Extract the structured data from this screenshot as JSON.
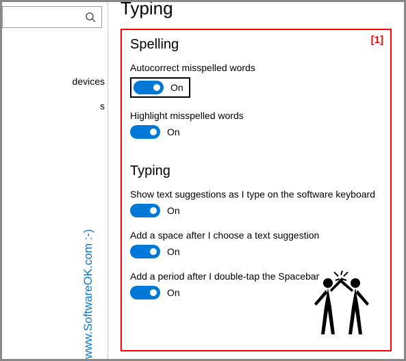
{
  "page_title": "Typing",
  "sidebar": {
    "items": [
      {
        "label": "devices"
      },
      {
        "label": "s"
      }
    ]
  },
  "badge": "[1]",
  "sections": [
    {
      "heading": "Spelling",
      "settings": [
        {
          "label": "Autocorrect misspelled words",
          "state": "On",
          "highlighted": true
        },
        {
          "label": "Highlight misspelled words",
          "state": "On"
        }
      ]
    },
    {
      "heading": "Typing",
      "settings": [
        {
          "label": "Show text suggestions as I type on the software keyboard",
          "state": "On"
        },
        {
          "label": "Add a space after I choose a text suggestion",
          "state": "On"
        },
        {
          "label": "Add a period after I double-tap the Spacebar",
          "state": "On"
        }
      ]
    }
  ],
  "watermark": "www.SoftwareOK.com :-)"
}
